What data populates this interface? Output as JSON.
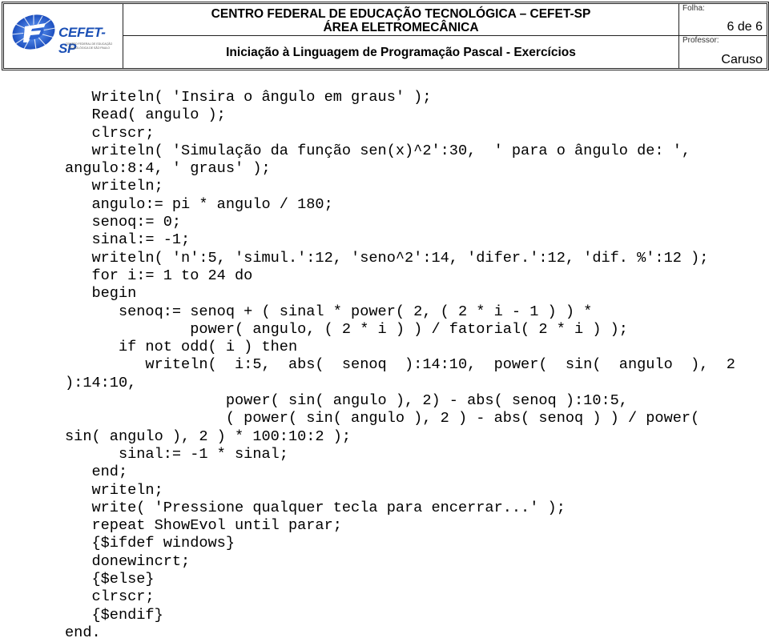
{
  "header": {
    "logo": {
      "name": "CEFET-SP",
      "subtitle": "CENTRO FEDERAL DE EDUCAÇÃO TECNOLÓGICA DE SÃO PAULO"
    },
    "title_line1": "CENTRO FEDERAL DE EDUCAÇÃO TECNOLÓGICA – CEFET-SP",
    "title_line2": "ÁREA ELETROMECÂNICA",
    "subtitle": "Iniciação à Linguagem de Programação Pascal - Exercícios",
    "folha_label": "Folha:",
    "folha_value": "6 de 6",
    "professor_label": "Professor:",
    "professor_value": "Caruso"
  },
  "code": {
    "lines": [
      "   Writeln( 'Insira o ângulo em graus' );",
      "   Read( angulo );",
      "   clrscr;",
      "   writeln( 'Simulação da função sen(x)^2':30,  ' para o ângulo de: ',",
      "angulo:8:4, ' graus' );",
      "   writeln;",
      "   angulo:= pi * angulo / 180;",
      "   senoq:= 0;",
      "   sinal:= -1;",
      "   writeln( 'n':5, 'simul.':12, 'seno^2':14, 'difer.':12, 'dif. %':12 );",
      "   for i:= 1 to 24 do",
      "   begin",
      "      senoq:= senoq + ( sinal * power( 2, ( 2 * i - 1 ) ) *",
      "              power( angulo, ( 2 * i ) ) / fatorial( 2 * i ) );",
      "      if not odd( i ) then",
      "         writeln(  i:5,  abs(  senoq  ):14:10,  power(  sin(  angulo  ),  2",
      "):14:10,",
      "                  power( sin( angulo ), 2) - abs( senoq ):10:5,",
      "                  ( power( sin( angulo ), 2 ) - abs( senoq ) ) / power(",
      "sin( angulo ), 2 ) * 100:10:2 );",
      "      sinal:= -1 * sinal;",
      "   end;",
      "   writeln;",
      "   write( 'Pressione qualquer tecla para encerrar...' );",
      "   repeat ShowEvol until parar;",
      "   {$ifdef windows}",
      "   donewincrt;",
      "   {$else}",
      "   clrscr;",
      "   {$endif}",
      "end."
    ]
  }
}
